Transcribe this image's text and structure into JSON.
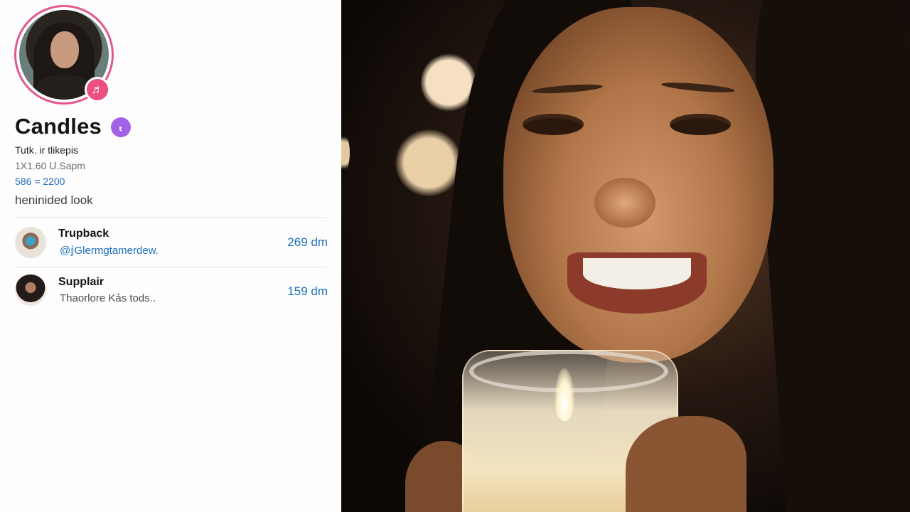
{
  "profile": {
    "name": "Candles",
    "badge_icon": "music-note-icon",
    "verified_glyph": "ₜ",
    "tagline": "Tutk. ir tlikepis",
    "time": "1X1.60 ᑌ.Sapm",
    "stats": "586 = 2200",
    "bio": "heninided look"
  },
  "list": [
    {
      "name": "Trupback",
      "sub": "@𝕛Glermgtamerdew.",
      "meta": "269 dm"
    },
    {
      "name": "Supplair",
      "sub": "Thaorlore Kảs tods..",
      "meta": "159 dm"
    }
  ],
  "colors": {
    "accent_blue": "#1e6fbf",
    "ring_pink": "#e4588f",
    "badge_pink": "#ec4f7d",
    "verified_purple": "#a361e8"
  },
  "photo": {
    "icon": "candle-portrait-image"
  }
}
